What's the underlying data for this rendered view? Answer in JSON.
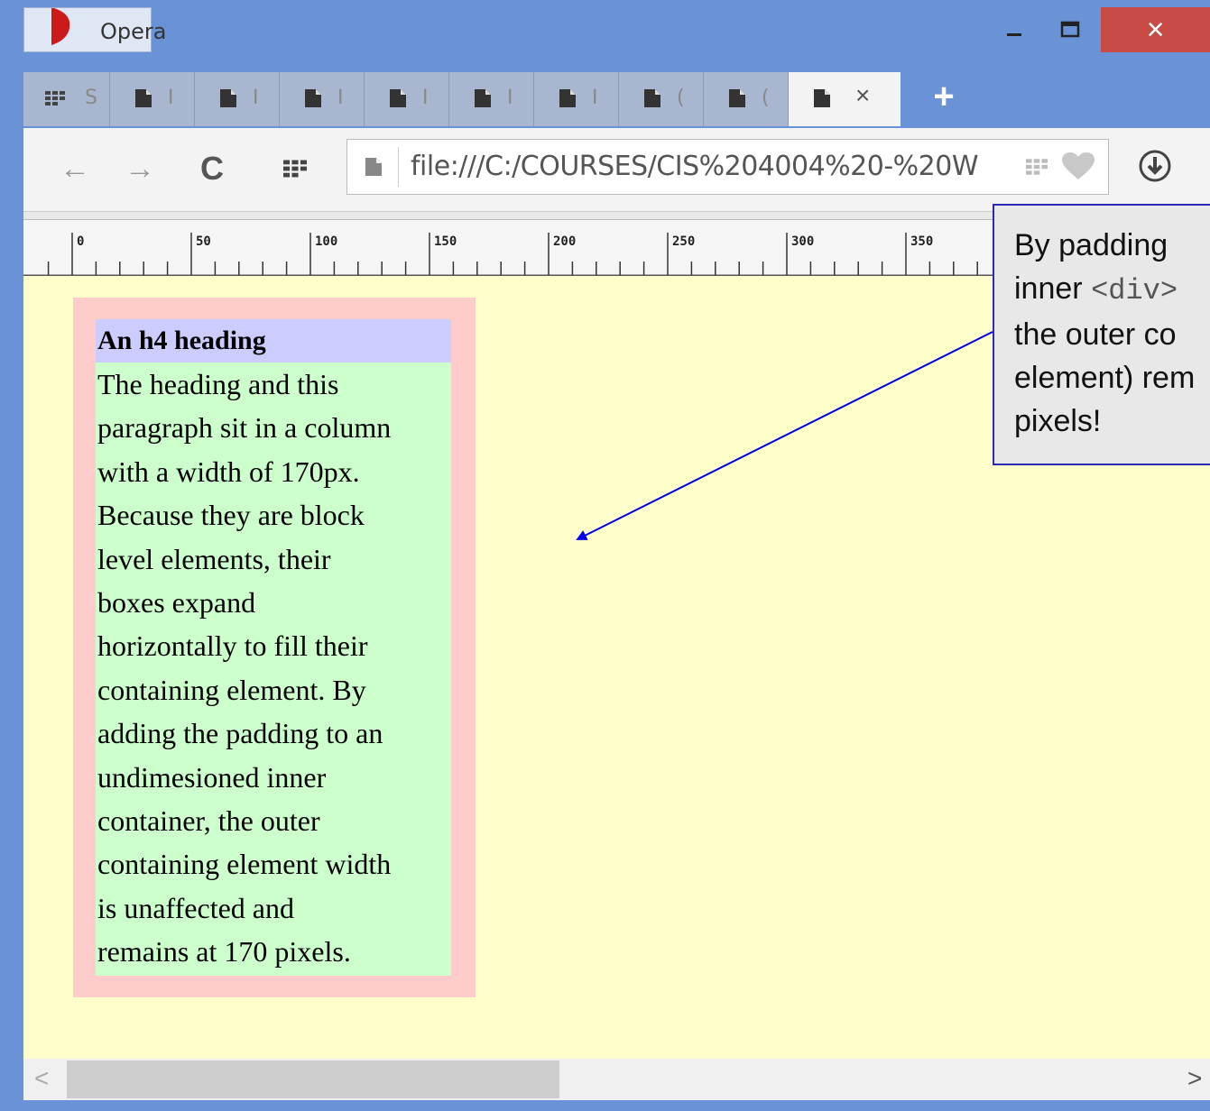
{
  "window": {
    "app_label": "Opera",
    "minimize_glyph": "_",
    "maximize_glyph": "☐",
    "close_glyph": "×"
  },
  "tabs": [
    {
      "label": "S",
      "icon": "speed-dial-icon"
    },
    {
      "label": "I",
      "icon": "document-icon"
    },
    {
      "label": "I",
      "icon": "document-icon"
    },
    {
      "label": "I",
      "icon": "document-icon"
    },
    {
      "label": "I",
      "icon": "document-icon"
    },
    {
      "label": "I",
      "icon": "document-icon"
    },
    {
      "label": "I",
      "icon": "document-icon"
    },
    {
      "label": "(",
      "icon": "document-icon"
    },
    {
      "label": "(",
      "icon": "document-icon"
    },
    {
      "label": "",
      "icon": "document-icon",
      "active": true,
      "close": "×"
    }
  ],
  "new_tab_label": "+",
  "toolbar": {
    "back": "←",
    "forward": "→",
    "reload": "C",
    "url": "file:///C:/COURSES/CIS%204004%20-%20W"
  },
  "ruler": {
    "labels": [
      "0",
      "50",
      "100",
      "150",
      "200",
      "250",
      "300",
      "350"
    ]
  },
  "page": {
    "heading": "An h4 heading",
    "paragraph_lines": [
      "The heading and this",
      "paragraph sit in a column",
      "with a width of 170px.",
      "Because they are block",
      "level elements, their",
      "boxes expand",
      "horizontally to fill their",
      "containing element. By",
      "adding the padding to an",
      "undimesioned inner",
      "container, the outer",
      "containing element width",
      "is unaffected and",
      "remains at 170 pixels."
    ]
  },
  "callout": {
    "line1": "By padding",
    "line2_prefix": "inner ",
    "line2_code": "<div>",
    "line3": "the outer co",
    "line4": "element) rem",
    "line5": "pixels!"
  },
  "scroll": {
    "left": "<",
    "right": ">"
  },
  "colors": {
    "page_bg": "#ffffcc",
    "outer_div": "#ffcccc",
    "inner_div": "#ccffcc",
    "heading_bg": "#ccccff",
    "arrow": "#0000ee"
  }
}
